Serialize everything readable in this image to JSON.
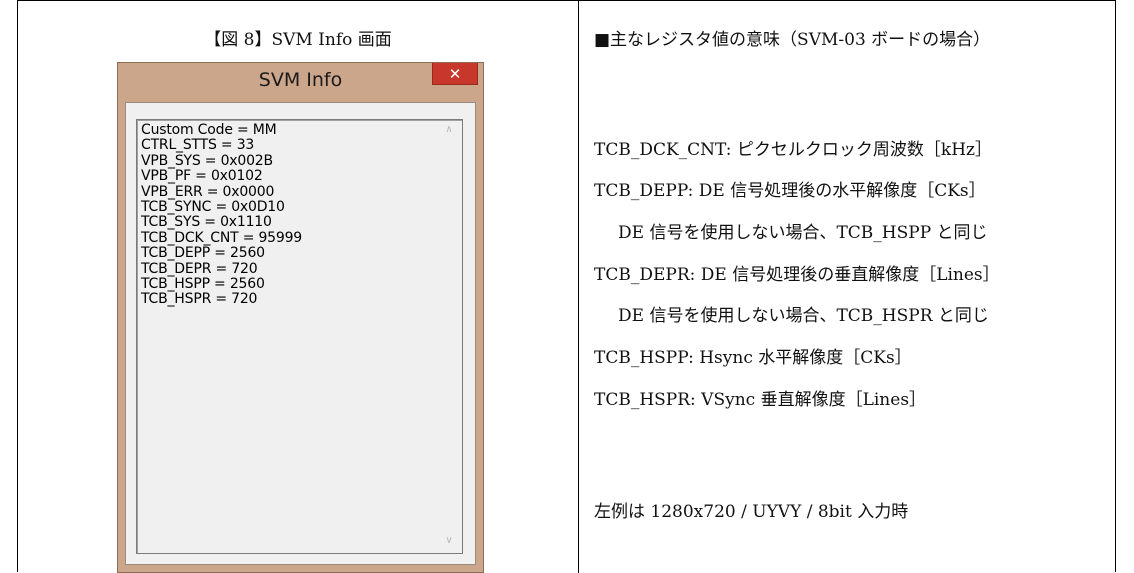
{
  "left": {
    "caption": "【図 8】SVM Info 画面",
    "window": {
      "title": "SVM Info",
      "close_glyph": "✕",
      "lines": [
        "Custom Code = MM",
        "CTRL_STTS = 33",
        "VPB_SYS = 0x002B",
        "VPB_PF = 0x0102",
        "VPB_ERR = 0x0000",
        "TCB_SYNC = 0x0D10",
        "TCB_SYS = 0x1110",
        "TCB_DCK_CNT = 95999",
        "TCB_DEPP = 2560",
        "TCB_DEPR = 720",
        "TCB_HSPP = 2560",
        "TCB_HSPR = 720"
      ],
      "scroll_up_glyph": "∧",
      "scroll_down_glyph": "∨"
    }
  },
  "right": {
    "heading": "■主なレジスタ値の意味（SVM-03 ボードの場合）",
    "desc": [
      "TCB_DCK_CNT: ピクセルクロック周波数［kHz］",
      "TCB_DEPP: DE 信号処理後の水平解像度［CKs］",
      "DE 信号を使用しない場合、TCB_HSPP と同じ",
      "TCB_DEPR: DE 信号処理後の垂直解像度［Lines］",
      "DE 信号を使用しない場合、TCB_HSPR と同じ",
      "TCB_HSPP: Hsync 水平解像度［CKs］",
      "TCB_HSPR: VSync 垂直解像度［Lines］"
    ],
    "note": "左例は 1280x720 / UYVY / 8bit 入力時"
  }
}
